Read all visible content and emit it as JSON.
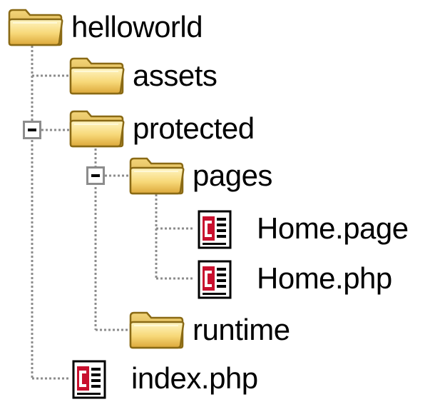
{
  "tree": {
    "root": {
      "label": "helloworld",
      "icon": "folder-icon"
    },
    "assets": {
      "label": "assets",
      "icon": "folder-icon"
    },
    "protected": {
      "label": "protected",
      "icon": "folder-icon",
      "expanded": true
    },
    "pages": {
      "label": "pages",
      "icon": "folder-icon",
      "expanded": true
    },
    "home_page": {
      "label": "Home.page",
      "icon": "code-file-icon"
    },
    "home_php": {
      "label": "Home.php",
      "icon": "code-file-icon"
    },
    "runtime": {
      "label": "runtime",
      "icon": "folder-icon"
    },
    "index_php": {
      "label": "index.php",
      "icon": "code-file-icon"
    }
  },
  "colors": {
    "folder_light": "#fff3b0",
    "folder_dark": "#e6b441",
    "folder_outline": "#8a6a15",
    "file_accent": "#c8102e",
    "connector": "#8c8c8c"
  }
}
